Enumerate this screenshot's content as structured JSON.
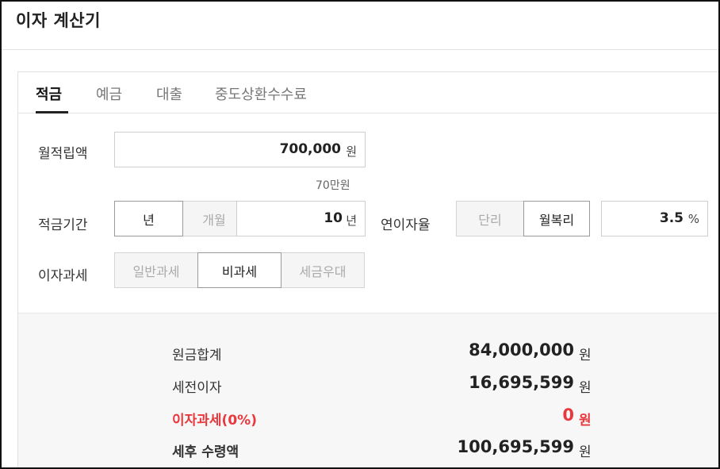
{
  "app": {
    "title": "이자 계산기"
  },
  "tabs": [
    {
      "label": "적금",
      "active": true
    },
    {
      "label": "예금",
      "active": false
    },
    {
      "label": "대출",
      "active": false
    },
    {
      "label": "중도상환수수료",
      "active": false
    }
  ],
  "form": {
    "monthly": {
      "label": "월적립액",
      "value": "700,000",
      "unit": "원",
      "hint": "70만원"
    },
    "period": {
      "label": "적금기간",
      "options": [
        {
          "label": "년",
          "selected": true
        },
        {
          "label": "개월",
          "selected": false
        }
      ],
      "value": "10",
      "unit": "년"
    },
    "rate": {
      "label": "연이자율",
      "options": [
        {
          "label": "단리",
          "selected": false
        },
        {
          "label": "월복리",
          "selected": true
        }
      ],
      "value": "3.5",
      "unit": "%"
    },
    "tax": {
      "label": "이자과세",
      "options": [
        {
          "label": "일반과세",
          "selected": false
        },
        {
          "label": "비과세",
          "selected": true
        },
        {
          "label": "세금우대",
          "selected": false
        }
      ]
    }
  },
  "results": [
    {
      "label": "원금합계",
      "value": "84,000,000",
      "unit": "원"
    },
    {
      "label": "세전이자",
      "value": "16,695,599",
      "unit": "원"
    },
    {
      "label": "이자과세(0%)",
      "value": "0",
      "unit": "원"
    },
    {
      "label": "세후 수령액",
      "value": "100,695,599",
      "unit": "원"
    }
  ],
  "colors": {
    "accent_red": "#e8383d",
    "tab_active": "#111111",
    "muted": "#aaaaaa"
  }
}
